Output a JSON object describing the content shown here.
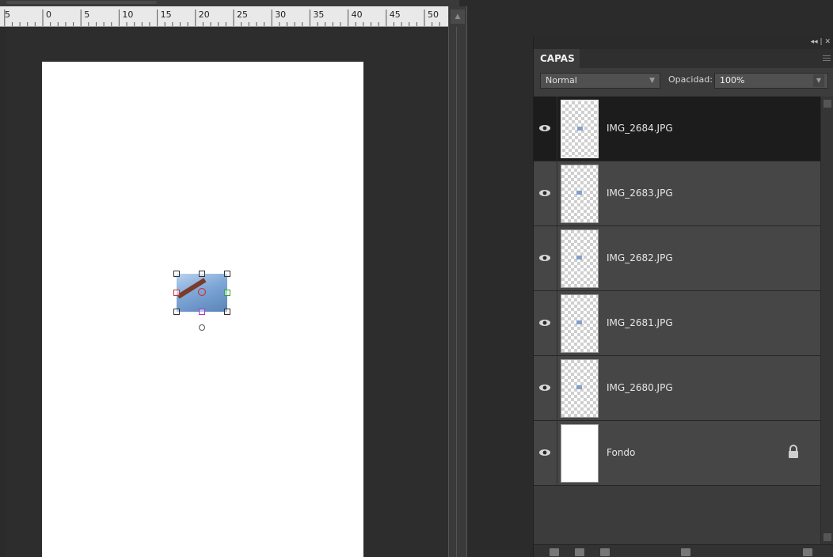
{
  "ruler": {
    "labels": [
      "5",
      "0",
      "5",
      "10",
      "15",
      "20",
      "25",
      "30",
      "35",
      "40",
      "45",
      "50"
    ]
  },
  "panel": {
    "tab_label": "CAPAS",
    "blend_mode": "Normal",
    "opacity_label": "Opacidad:",
    "opacity_value": "100%"
  },
  "layers": [
    {
      "name": "IMG_2684.JPG",
      "selected": true,
      "visible": true,
      "transparent": true
    },
    {
      "name": "IMG_2683.JPG",
      "selected": false,
      "visible": true,
      "transparent": true
    },
    {
      "name": "IMG_2682.JPG",
      "selected": false,
      "visible": true,
      "transparent": true
    },
    {
      "name": "IMG_2681.JPG",
      "selected": false,
      "visible": true,
      "transparent": true
    },
    {
      "name": "IMG_2680.JPG",
      "selected": false,
      "visible": true,
      "transparent": true
    },
    {
      "name": "Fondo",
      "selected": false,
      "visible": true,
      "transparent": false,
      "locked": true
    }
  ],
  "icons": {
    "eye": "eye-icon",
    "lock": "lock-icon",
    "menu": "panel-menu-icon"
  },
  "colors": {
    "selected_row": "#1c1c1c",
    "row": "#464646",
    "panel_bg": "#3c3c3c",
    "workspace_bg": "#2b2b2b"
  }
}
